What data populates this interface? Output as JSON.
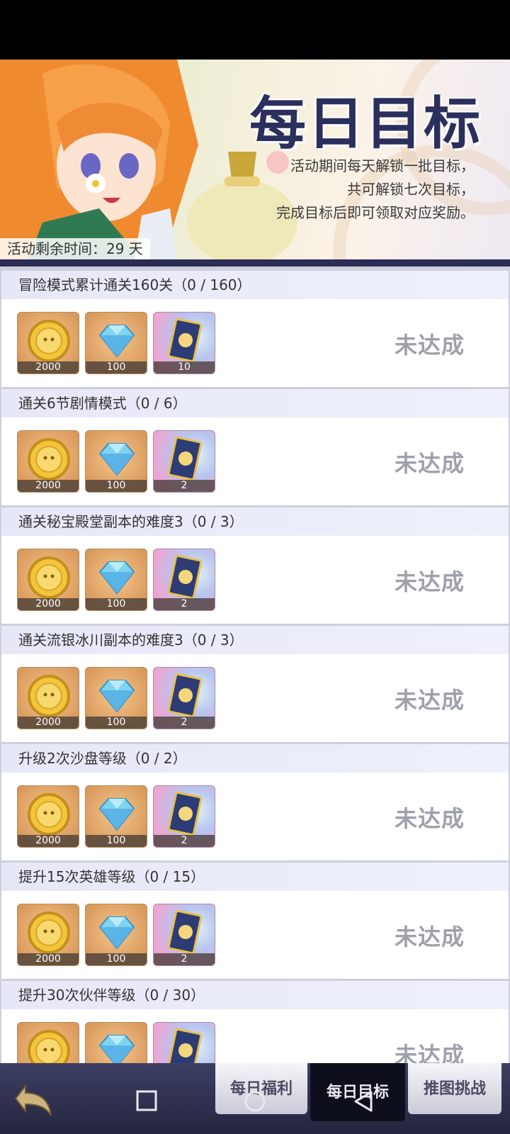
{
  "banner": {
    "title": "每日目标",
    "description": [
      "活动期间每天解锁一批目标，",
      "共可解锁七次目标，",
      "完成目标后即可领取对应奖励。"
    ],
    "remaining_time": "活动剩余时间：29 天"
  },
  "tasks": [
    {
      "title": "冒险模式累计通关160关（0 / 160）",
      "rewards": [
        "2000",
        "100",
        "10"
      ],
      "status": "未达成"
    },
    {
      "title": "通关6节剧情模式（0 / 6）",
      "rewards": [
        "2000",
        "100",
        "2"
      ],
      "status": "未达成"
    },
    {
      "title": "通关秘宝殿堂副本的难度3（0 / 3）",
      "rewards": [
        "2000",
        "100",
        "2"
      ],
      "status": "未达成"
    },
    {
      "title": "通关流银冰川副本的难度3（0 / 3）",
      "rewards": [
        "2000",
        "100",
        "2"
      ],
      "status": "未达成"
    },
    {
      "title": "升级2次沙盘等级（0 / 2）",
      "rewards": [
        "2000",
        "100",
        "2"
      ],
      "status": "未达成"
    },
    {
      "title": "提升15次英雄等级（0 / 15）",
      "rewards": [
        "2000",
        "100",
        "2"
      ],
      "status": "未达成"
    },
    {
      "title": "提升30次伙伴等级（0 / 30）",
      "rewards": [
        "",
        "",
        ""
      ],
      "status": "未达成"
    }
  ],
  "reward_icons": [
    "gold-coin-icon",
    "diamond-icon",
    "card-icon"
  ],
  "tabs": [
    {
      "label": "每日福利",
      "active": false
    },
    {
      "label": "每日目标",
      "active": true
    },
    {
      "label": "推图挑战",
      "active": false
    }
  ],
  "colors": {
    "status_text": "#9ea0ab",
    "header_bg": "#e6e8f8",
    "tab_active": "#0e0f1c"
  }
}
